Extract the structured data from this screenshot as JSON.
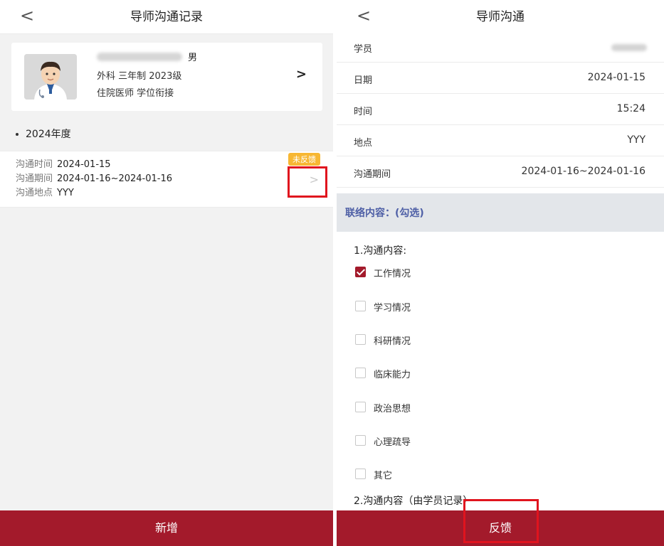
{
  "left": {
    "nav": {
      "back_glyph": "<",
      "title": "导师沟通记录"
    },
    "profile": {
      "sex": "男",
      "line2": "外科 三年制 2023级",
      "line3": "住院医师 学位衔接",
      "chevron": ">"
    },
    "year_label": "2024年度",
    "record": {
      "badge": "未反馈",
      "rows": [
        {
          "label": "沟通时间",
          "value": "2024-01-15"
        },
        {
          "label": "沟通期间",
          "value": "2024-01-16~2024-01-16"
        },
        {
          "label": "沟通地点",
          "value": "YYY"
        }
      ],
      "chevron": ">"
    },
    "add_button": "新增"
  },
  "right": {
    "nav": {
      "back_glyph": "<",
      "title": "导师沟通"
    },
    "fields": {
      "student": {
        "label": "学员"
      },
      "date": {
        "label": "日期",
        "value": "2024-01-15"
      },
      "time": {
        "label": "时间",
        "value": "15:24"
      },
      "place": {
        "label": "地点",
        "value": "YYY"
      },
      "period": {
        "label": "沟通期间",
        "value": "2024-01-16~2024-01-16"
      }
    },
    "section_title": "联络内容：(勾选)",
    "question1": "1.沟通内容:",
    "options": [
      {
        "label": "工作情况",
        "checked": true
      },
      {
        "label": "学习情况",
        "checked": false
      },
      {
        "label": "科研情况",
        "checked": false
      },
      {
        "label": "临床能力",
        "checked": false
      },
      {
        "label": "政治思想",
        "checked": false
      },
      {
        "label": "心理疏导",
        "checked": false
      },
      {
        "label": "其它",
        "checked": false
      }
    ],
    "question2": "2.沟通内容（由学员记录）",
    "feedback_button": "反馈"
  },
  "colors": {
    "brand": "#a31a2b",
    "badge": "#f7b733",
    "section_text": "#4e5fa6",
    "highlight": "#e0141e"
  }
}
